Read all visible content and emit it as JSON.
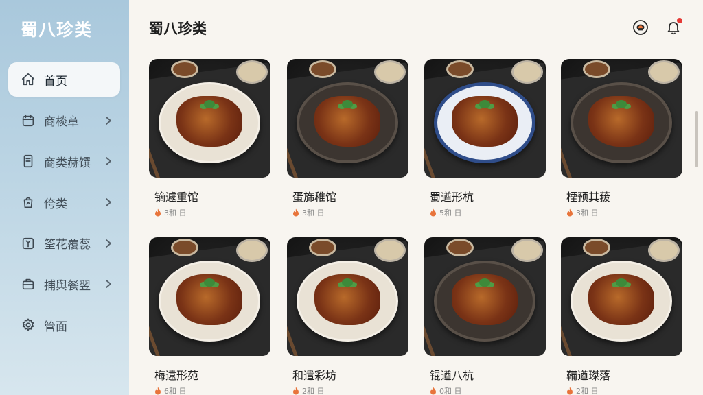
{
  "app": {
    "brand": "蜀八珍类"
  },
  "header": {
    "title": "蜀八珍类"
  },
  "sidebar": {
    "items": [
      {
        "label": "首页",
        "icon": "home-icon",
        "active": true,
        "chevron": false
      },
      {
        "label": "商棪章",
        "icon": "calendar-icon",
        "active": false,
        "chevron": true
      },
      {
        "label": "商类赫馔",
        "icon": "document-icon",
        "active": false,
        "chevron": true
      },
      {
        "label": "侉类",
        "icon": "bag-icon",
        "active": false,
        "chevron": true
      },
      {
        "label": "筌花覆蕊",
        "icon": "chart-icon",
        "active": false,
        "chevron": true
      },
      {
        "label": "捕舆餐翌",
        "icon": "briefcase-icon",
        "active": false,
        "chevron": true
      },
      {
        "label": "管面",
        "icon": "gear-icon",
        "active": false,
        "chevron": false
      }
    ]
  },
  "dishes": [
    {
      "name": "镝遽重馆",
      "meta": "3和 日"
    },
    {
      "name": "蛋旆稚馆",
      "meta": "3和 日"
    },
    {
      "name": "蜀遒形杭",
      "meta": "5和 日"
    },
    {
      "name": "㮒预其菝",
      "meta": "3和 日"
    },
    {
      "name": "梅遠形苑",
      "meta": "6和 日"
    },
    {
      "name": "和遣彩坊",
      "meta": "2和 日"
    },
    {
      "name": "锟遒八杭",
      "meta": "0和 日"
    },
    {
      "name": "鞴遒㻧落",
      "meta": "2和 日"
    }
  ],
  "colors": {
    "sidebar_top": "#a9c8dc",
    "accent_fire": "#e8743b",
    "badge": "#e53935"
  }
}
